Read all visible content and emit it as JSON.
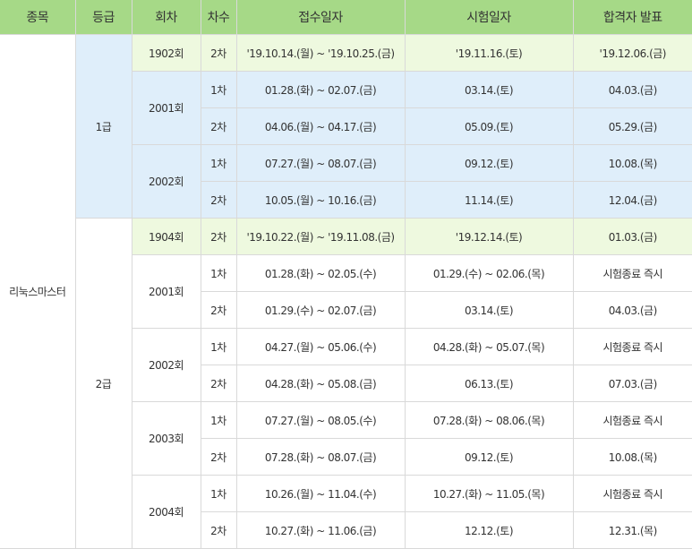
{
  "headers": [
    "종목",
    "등급",
    "회차",
    "차수",
    "접수일자",
    "시험일자",
    "합격자 발표"
  ],
  "subject": "리눅스마스터",
  "grade1": {
    "label": "1급",
    "rows": [
      {
        "round": "1902회",
        "seq": "2차",
        "reg": "'19.10.14.(월) ~ '19.10.25.(금)",
        "exam": "'19.11.16.(토)",
        "result": "'19.12.06.(금)"
      },
      {
        "round": "2001회",
        "seq": "1차",
        "reg": "01.28.(화) ~ 02.07.(금)",
        "exam": "03.14.(토)",
        "result": "04.03.(금)"
      },
      {
        "round": "",
        "seq": "2차",
        "reg": "04.06.(월) ~ 04.17.(금)",
        "exam": "05.09.(토)",
        "result": "05.29.(금)"
      },
      {
        "round": "2002회",
        "seq": "1차",
        "reg": "07.27.(월) ~ 08.07.(금)",
        "exam": "09.12.(토)",
        "result": "10.08.(목)"
      },
      {
        "round": "",
        "seq": "2차",
        "reg": "10.05.(월) ~ 10.16.(금)",
        "exam": "11.14.(토)",
        "result": "12.04.(금)"
      }
    ]
  },
  "grade2": {
    "label": "2급",
    "rows": [
      {
        "round": "1904회",
        "seq": "2차",
        "reg": "'19.10.22.(월) ~ '19.11.08.(금)",
        "exam": "'19.12.14.(토)",
        "result": "01.03.(금)"
      },
      {
        "round": "2001회",
        "seq": "1차",
        "reg": "01.28.(화) ~ 02.05.(수)",
        "exam": "01.29.(수) ~ 02.06.(목)",
        "result": "시험종료 즉시"
      },
      {
        "round": "",
        "seq": "2차",
        "reg": "01.29.(수) ~ 02.07.(금)",
        "exam": "03.14.(토)",
        "result": "04.03.(금)"
      },
      {
        "round": "2002회",
        "seq": "1차",
        "reg": "04.27.(월) ~ 05.06.(수)",
        "exam": "04.28.(화) ~ 05.07.(목)",
        "result": "시험종료 즉시"
      },
      {
        "round": "",
        "seq": "2차",
        "reg": "04.28.(화) ~ 05.08.(금)",
        "exam": "06.13.(토)",
        "result": "07.03.(금)"
      },
      {
        "round": "2003회",
        "seq": "1차",
        "reg": "07.27.(월) ~ 08.05.(수)",
        "exam": "07.28.(화) ~ 08.06.(목)",
        "result": "시험종료 즉시"
      },
      {
        "round": "",
        "seq": "2차",
        "reg": "07.28.(화) ~ 08.07.(금)",
        "exam": "09.12.(토)",
        "result": "10.08.(목)"
      },
      {
        "round": "2004회",
        "seq": "1차",
        "reg": "10.26.(월) ~ 11.04.(수)",
        "exam": "10.27.(화) ~ 11.05.(목)",
        "result": "시험종료 즉시"
      },
      {
        "round": "",
        "seq": "2차",
        "reg": "10.27.(화) ~ 11.06.(금)",
        "exam": "12.12.(토)",
        "result": "12.31.(목)"
      }
    ]
  }
}
